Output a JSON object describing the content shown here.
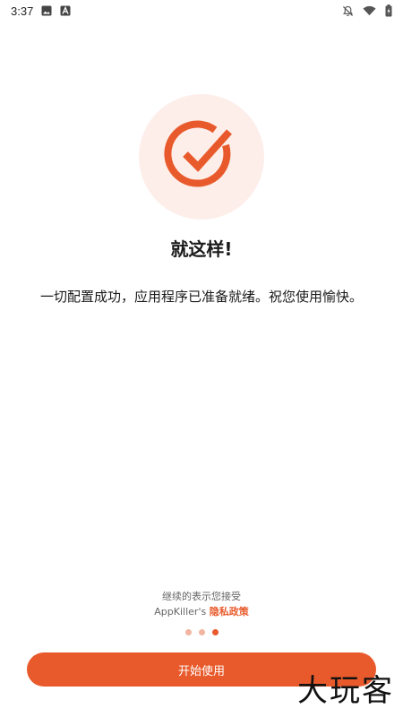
{
  "status_bar": {
    "time": "3:37",
    "left_icons": [
      "image-icon",
      "font-icon"
    ],
    "right_icons": [
      "notifications-off-icon",
      "wifi-icon",
      "battery-icon"
    ]
  },
  "hero": {
    "icon": "check-circle-icon",
    "title": "就这样!",
    "subtitle": "一切配置成功，应用程序已准备就绪。祝您使用愉快。"
  },
  "footer": {
    "consent_text": "继续的表示您接受",
    "app_name": "AppKiller's",
    "policy_link": "隐私政策"
  },
  "pager": {
    "total": 3,
    "active_index": 2
  },
  "button": {
    "label": "开始使用"
  },
  "watermark": {
    "text": "大玩客"
  },
  "colors": {
    "accent": "#e85a2b",
    "accent_light": "#fdeeea",
    "dot_inactive": "#f2b5a1"
  }
}
